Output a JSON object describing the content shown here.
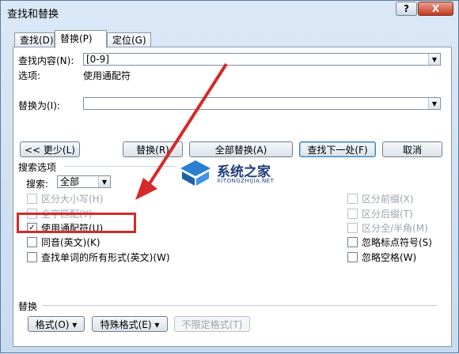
{
  "dialog": {
    "title": "查找和替换",
    "help_label": "?",
    "close_label": "X"
  },
  "tabs": [
    {
      "label": "查找(D)"
    },
    {
      "label": "替换(P)"
    },
    {
      "label": "定位(G)"
    }
  ],
  "find": {
    "label": "查找内容(N):",
    "value": "[0-9]",
    "options_label": "选项:",
    "options_value": "使用通配符"
  },
  "replace": {
    "label": "替换为(I):",
    "value": ""
  },
  "buttons": {
    "less": "<< 更少(L)",
    "replace": "替换(R)",
    "replace_all": "全部替换(A)",
    "find_next": "查找下一处(F)",
    "cancel": "取消"
  },
  "search_options": {
    "header": "搜索选项",
    "search_label": "搜索:",
    "search_value": "全部",
    "left": [
      {
        "label": "区分大小写(H)",
        "checked": false,
        "enabled": false
      },
      {
        "label": "全字匹配(Y)",
        "checked": false,
        "enabled": false
      },
      {
        "label": "使用通配符(U)",
        "checked": true,
        "enabled": true
      },
      {
        "label": "同音(英文)(K)",
        "checked": false,
        "enabled": true
      },
      {
        "label": "查找单词的所有形式(英文)(W)",
        "checked": false,
        "enabled": true
      }
    ],
    "right": [
      {
        "label": "区分前缀(X)",
        "checked": false,
        "enabled": false
      },
      {
        "label": "区分后缀(T)",
        "checked": false,
        "enabled": false
      },
      {
        "label": "区分全/半角(M)",
        "checked": false,
        "enabled": false
      },
      {
        "label": "忽略标点符号(S)",
        "checked": false,
        "enabled": true
      },
      {
        "label": "忽略空格(W)",
        "checked": false,
        "enabled": true
      }
    ]
  },
  "replace_section": {
    "header": "替换",
    "format": "格式(O) ▾",
    "special": "特殊格式(E) ▾",
    "no_format": "不限定格式(T)"
  },
  "watermark": {
    "cn": "系统之家",
    "en": "XITONGZHIJIA.NET"
  },
  "colors": {
    "annotation_red": "#d42a2a",
    "titlebar": "#dbe8f6"
  }
}
